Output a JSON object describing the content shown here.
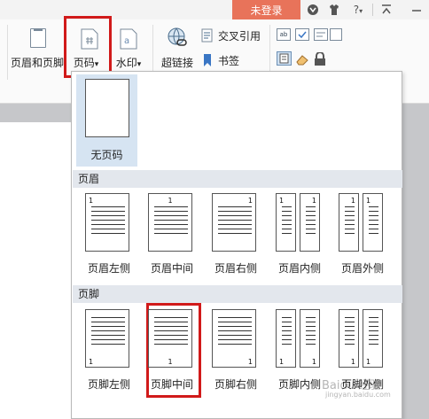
{
  "topbar": {
    "login_label": "未登录",
    "icons": [
      "fold-icon",
      "shirt-icon",
      "help-icon",
      "collapse-icon",
      "minimize-icon"
    ],
    "help_label": "?"
  },
  "ribbon": {
    "header_footer_label": "页眉和页脚",
    "page_number_label": "页码",
    "watermark_label": "水印",
    "hyperlink_label": "超链接",
    "cross_ref_label": "交叉引用",
    "bookmark_label": "书签",
    "dropdown_arrow": "▾"
  },
  "panel": {
    "none_label": "无页码",
    "header_section_title": "页眉",
    "footer_section_title": "页脚",
    "header_items": [
      "页眉左侧",
      "页眉中间",
      "页眉右侧",
      "页眉内侧",
      "页眉外侧"
    ],
    "footer_items": [
      "页脚左侧",
      "页脚中间",
      "页脚右侧",
      "页脚内侧",
      "页脚外侧"
    ],
    "page_num": "1"
  },
  "watermark": {
    "text": "Baidu 经验",
    "sub": "jingyan.baidu.com"
  },
  "colors": {
    "accent": "#e8735a",
    "highlight_box": "#d11a1a",
    "selected_bg": "#d6e4f2",
    "section_bg": "#e3e7ed"
  }
}
